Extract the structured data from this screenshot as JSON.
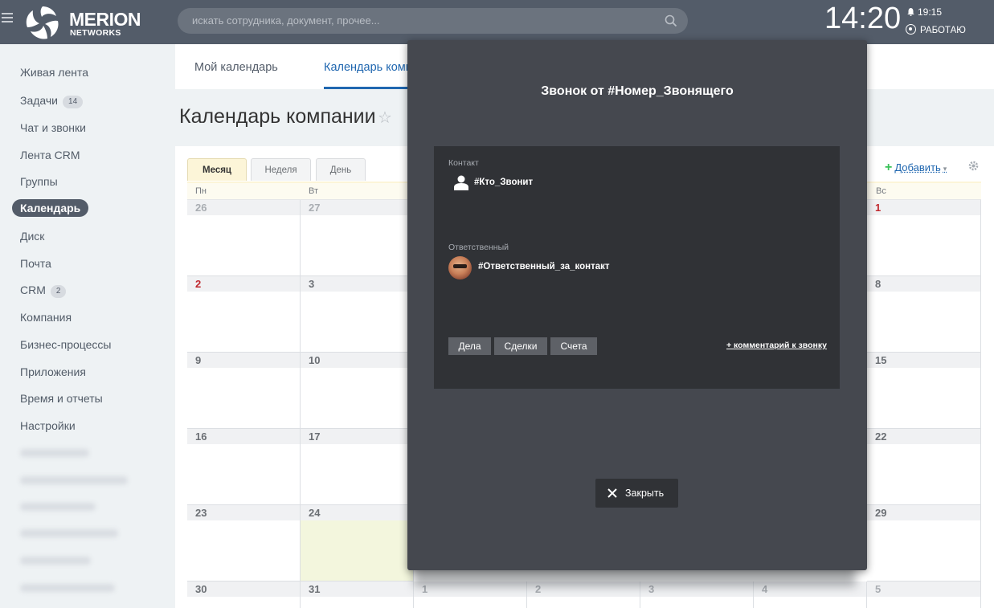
{
  "header": {
    "logo_main": "MERION",
    "logo_sub": "NETWORKS",
    "search_placeholder": "искать сотрудника, документ, прочее...",
    "clock": "14:20",
    "alarm": "19:15",
    "status": "РАБОТАЮ"
  },
  "sidebar": {
    "items": [
      {
        "label": "Живая лента"
      },
      {
        "label": "Задачи",
        "badge": "14"
      },
      {
        "label": "Чат и звонки"
      },
      {
        "label": "Лента CRM"
      },
      {
        "label": "Группы"
      },
      {
        "label": "Календарь"
      },
      {
        "label": "Диск"
      },
      {
        "label": "Почта"
      },
      {
        "label": "CRM",
        "badge": "2"
      },
      {
        "label": "Компания"
      },
      {
        "label": "Бизнес-процессы"
      },
      {
        "label": "Приложения"
      },
      {
        "label": "Время и отчеты"
      },
      {
        "label": "Настройки"
      }
    ]
  },
  "tabs": {
    "my_calendar": "Мой календарь",
    "company_calendar": "Календарь компании"
  },
  "page_title": "Календарь компании",
  "calendar": {
    "views": [
      "Месяц",
      "Неделя",
      "День"
    ],
    "add_label": "Добавить",
    "days_of_week": [
      "Пн",
      "Вт",
      "Вс"
    ],
    "weeks": [
      [
        "26",
        "27",
        "1"
      ],
      [
        "2",
        "3",
        "8"
      ],
      [
        "9",
        "10",
        "15"
      ],
      [
        "16",
        "17",
        "22"
      ],
      [
        "23",
        "24",
        "29"
      ],
      [
        "30",
        "31",
        "1",
        "2",
        "3",
        "4",
        "5"
      ]
    ]
  },
  "call_popup": {
    "title": "Звонок от #Номер_Звонящего",
    "contact_label": "Контакт",
    "contact_value": "#Кто_Звонит",
    "responsible_label": "Ответственный",
    "responsible_value": "#Ответственный_за_контакт",
    "buttons": [
      "Дела",
      "Сделки",
      "Счета"
    ],
    "comment_link": "+ комментарий к звонку",
    "close_label": "Закрыть"
  },
  "colors": {
    "header_bg": "#535c69",
    "accent_blue": "#2067b0",
    "popup_bg": "#45484f",
    "popup_inner_bg": "#303236",
    "sunday_red": "#c0272d",
    "add_green": "#3bc25a"
  }
}
